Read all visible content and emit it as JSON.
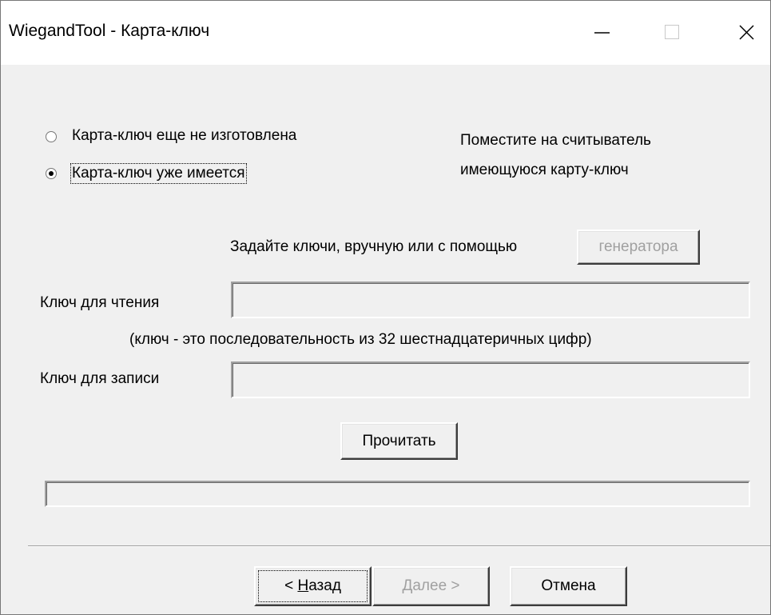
{
  "window": {
    "title": "WiegandTool - Карта-ключ"
  },
  "options": {
    "not_made_label": "Карта-ключ еще не изготовлена",
    "already_have_label": "Карта-ключ уже имеется",
    "selected": "already_have"
  },
  "instruction": {
    "line1": "Поместите на считыватель",
    "line2": "имеющуюся карту-ключ"
  },
  "keys": {
    "hint": "Задайте ключи, вручную или с помощью",
    "generator_button": "генератора",
    "read_key_label": "Ключ для чтения",
    "read_key_value": "",
    "key_format_note": "(ключ - это последовательность из 32 шестнадцатеричных цифр)",
    "write_key_label": "Ключ для записи",
    "write_key_value": ""
  },
  "actions": {
    "read_button": "Прочитать"
  },
  "progress": {
    "value": 0
  },
  "nav": {
    "back_prefix": "< ",
    "back_accel": "Н",
    "back_rest": "азад",
    "next_accel": "Д",
    "next_rest": "алее >",
    "cancel": "Отмена"
  }
}
